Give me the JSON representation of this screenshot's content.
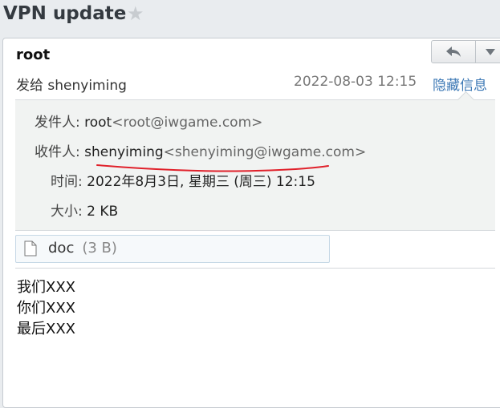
{
  "subject": "VPN update",
  "icons": {
    "star": "star-icon",
    "reply": "reply-icon",
    "more": "chevron-down-icon",
    "file": "file-icon"
  },
  "message": {
    "from_name": "root",
    "to_prefix": "发给",
    "to_name": "shenyiming",
    "date": "2022-08-03 12:15",
    "hide_details": "隐藏信息"
  },
  "headers": {
    "from_label": "发件人:",
    "from_name": "root",
    "from_email": "<root@iwgame.com>",
    "to_label": "收件人:",
    "to_name": "shenyiming",
    "to_email": "<shenyiming@iwgame.com>",
    "time_label": "时间:",
    "time_value": "2022年8月3日, 星期三 (周三) 12:15",
    "size_label": "大小:",
    "size_value": "2 KB"
  },
  "attachment": {
    "name": "doc",
    "size": "(3 B)"
  },
  "body_lines": [
    "我们XXX",
    "你们XXX",
    "最后XXX"
  ],
  "colors": {
    "accent": "#3c78b5",
    "annotation": "#e0202a",
    "header_bg": "#f1f3f2"
  }
}
